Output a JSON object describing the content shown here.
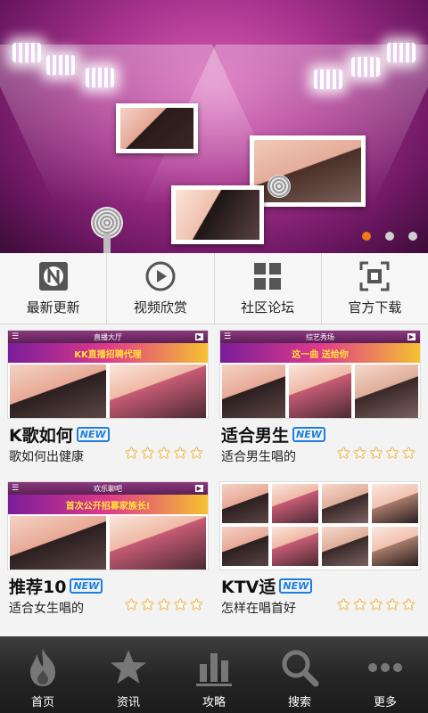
{
  "banner": {
    "slide_count": 3,
    "active_slide": 0
  },
  "quick_nav": [
    {
      "label": "最新更新",
      "icon": "n-logo-icon"
    },
    {
      "label": "视频欣赏",
      "icon": "play-icon"
    },
    {
      "label": "社区论坛",
      "icon": "grid-icon"
    },
    {
      "label": "官方下载",
      "icon": "download-frame-icon"
    }
  ],
  "cards": [
    {
      "screen_header": "直播大厅",
      "screen_banner": "KK直播招聘代理",
      "title": "K歌如何",
      "badge": "NEW",
      "subtitle": "歌如何出健康",
      "rating": 5
    },
    {
      "screen_header": "综艺秀场",
      "screen_banner": "这一曲 送给你",
      "title": "适合男生",
      "badge": "NEW",
      "subtitle": "适合男生唱的",
      "rating": 5
    },
    {
      "screen_header": "欢乐聊吧",
      "screen_banner": "首次公开招募家族长!",
      "title": "推荐10",
      "badge": "NEW",
      "subtitle": "适合女生唱的",
      "rating": 5
    },
    {
      "screen_header": "",
      "screen_banner": "",
      "title": "KTV适",
      "badge": "NEW",
      "subtitle": "怎样在唱首好",
      "rating": 5
    }
  ],
  "tabbar": [
    {
      "label": "首页",
      "icon": "flame-icon"
    },
    {
      "label": "资讯",
      "icon": "star-icon"
    },
    {
      "label": "攻略",
      "icon": "bar-chart-icon"
    },
    {
      "label": "搜索",
      "icon": "search-icon"
    },
    {
      "label": "更多",
      "icon": "more-dots-icon"
    }
  ]
}
